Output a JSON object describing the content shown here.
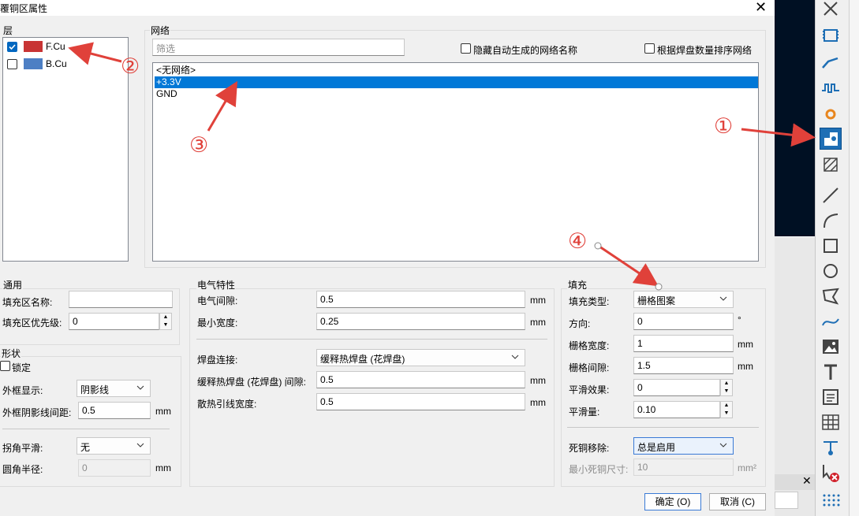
{
  "dialog": {
    "title": "覆铜区属性",
    "close": "✕"
  },
  "layers": {
    "label": "层",
    "items": [
      {
        "name": "F.Cu",
        "checked": true,
        "color": "#c83434"
      },
      {
        "name": "B.Cu",
        "checked": false,
        "color": "#4d7fc4"
      }
    ]
  },
  "nets": {
    "label": "网络",
    "filter_placeholder": "筛选",
    "hide_auto_label": "隐藏自动生成的网络名称",
    "sort_by_pads_label": "根据焊盘数量排序网络",
    "items": [
      "<无网络>",
      "+3.3V",
      "GND"
    ],
    "selected": "+3.3V"
  },
  "general": {
    "label": "通用",
    "name_label": "填充区名称:",
    "name_value": "",
    "priority_label": "填充区优先级:",
    "priority_value": "0"
  },
  "shape": {
    "label": "形状",
    "lock_label": "锁定",
    "outline_label": "外框显示:",
    "outline_value": "阴影线",
    "hatch_pitch_label": "外框阴影线间距:",
    "hatch_pitch_value": "0.5",
    "hatch_pitch_unit": "mm",
    "corner_label": "拐角平滑:",
    "corner_value": "无",
    "radius_label": "圆角半径:",
    "radius_value": "0",
    "radius_unit": "mm"
  },
  "electrical": {
    "label": "电气特性",
    "clearance_label": "电气间隙:",
    "clearance_value": "0.5",
    "clearance_unit": "mm",
    "min_width_label": "最小宽度:",
    "min_width_value": "0.25",
    "min_width_unit": "mm",
    "pad_conn_label": "焊盘连接:",
    "pad_conn_value": "缓释热焊盘 (花焊盘)",
    "thermal_gap_label": "缓释热焊盘 (花焊盘) 间隙:",
    "thermal_gap_value": "0.5",
    "thermal_gap_unit": "mm",
    "spoke_width_label": "散热引线宽度:",
    "spoke_width_value": "0.5",
    "spoke_width_unit": "mm"
  },
  "fill": {
    "label": "填充",
    "type_label": "填充类型:",
    "type_value": "栅格图案",
    "orient_label": "方向:",
    "orient_value": "0",
    "orient_unit": "°",
    "hatch_width_label": "栅格宽度:",
    "hatch_width_value": "1",
    "hatch_width_unit": "mm",
    "hatch_gap_label": "栅格间隙:",
    "hatch_gap_value": "1.5",
    "hatch_gap_unit": "mm",
    "smooth_effort_label": "平滑效果:",
    "smooth_effort_value": "0",
    "smooth_amount_label": "平滑量:",
    "smooth_amount_value": "0.10",
    "island_label": "死铜移除:",
    "island_value": "总是启用",
    "min_island_label": "最小死铜尺寸:",
    "min_island_value": "10",
    "min_island_unit": "mm²"
  },
  "buttons": {
    "ok": "确定 (O)",
    "cancel": "取消 (C)"
  },
  "annotations": [
    "①",
    "②",
    "③",
    "④"
  ],
  "colors": {
    "accent": "#0078d7",
    "annotation": "#e0413a"
  }
}
